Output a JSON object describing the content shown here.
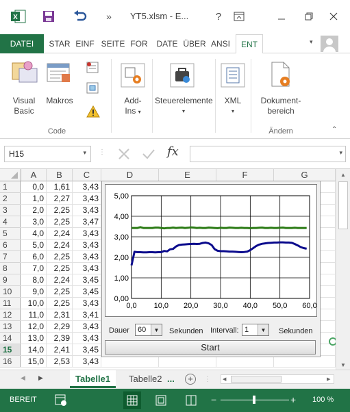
{
  "titlebar": {
    "app_icon": "excel-icon",
    "doc_title": "YT5.xlsm - E...",
    "help": "?",
    "colors": {
      "accent": "#217346"
    }
  },
  "ribbon_tabs": [
    "DATEI",
    "STAR",
    "EINF",
    "SEITE",
    "FOR",
    "DATE",
    "ÜBER",
    "ANSI",
    "ENT"
  ],
  "ribbon": {
    "code_group": {
      "visual_basic": [
        "Visual",
        "Basic"
      ],
      "makros": "Makros",
      "label": "Code"
    },
    "addins": [
      "Add-",
      "Ins"
    ],
    "controls": "Steuerelemente",
    "xml": "XML",
    "dokument": [
      "Dokument-",
      "bereich"
    ],
    "aendern_label": "Ändern"
  },
  "formula_bar": {
    "namebox": "H15",
    "fx": "fx",
    "value": ""
  },
  "grid": {
    "columns": [
      "A",
      "B",
      "C",
      "D",
      "E",
      "F",
      "G"
    ],
    "rows": [
      {
        "n": "1",
        "a": "0,0",
        "b": "1,61",
        "c": "3,43"
      },
      {
        "n": "2",
        "a": "1,0",
        "b": "2,27",
        "c": "3,43"
      },
      {
        "n": "3",
        "a": "2,0",
        "b": "2,25",
        "c": "3,43"
      },
      {
        "n": "4",
        "a": "3,0",
        "b": "2,25",
        "c": "3,47"
      },
      {
        "n": "5",
        "a": "4,0",
        "b": "2,24",
        "c": "3,43"
      },
      {
        "n": "6",
        "a": "5,0",
        "b": "2,24",
        "c": "3,43"
      },
      {
        "n": "7",
        "a": "6,0",
        "b": "2,25",
        "c": "3,43"
      },
      {
        "n": "8",
        "a": "7,0",
        "b": "2,25",
        "c": "3,43"
      },
      {
        "n": "9",
        "a": "8,0",
        "b": "2,24",
        "c": "3,45"
      },
      {
        "n": "10",
        "a": "9,0",
        "b": "2,25",
        "c": "3,45"
      },
      {
        "n": "11",
        "a": "10,0",
        "b": "2,25",
        "c": "3,43"
      },
      {
        "n": "12",
        "a": "11,0",
        "b": "2,31",
        "c": "3,41"
      },
      {
        "n": "13",
        "a": "12,0",
        "b": "2,29",
        "c": "3,43"
      },
      {
        "n": "14",
        "a": "13,0",
        "b": "2,39",
        "c": "3,43"
      },
      {
        "n": "15",
        "a": "14,0",
        "b": "2,41",
        "c": "3,45"
      },
      {
        "n": "16",
        "a": "15,0",
        "b": "2,53",
        "c": "3,43"
      }
    ],
    "selected_row": "15"
  },
  "form": {
    "dauer_label": "Dauer",
    "dauer_value": "60",
    "sekunden1": "Sekunden",
    "intervall_label": "Intervall:",
    "intervall_value": "1",
    "sekunden2": "Sekunden",
    "start": "Start"
  },
  "chart_data": {
    "type": "line",
    "title": "",
    "xlabel": "",
    "ylabel": "",
    "xlim": [
      0,
      60
    ],
    "ylim": [
      0,
      5
    ],
    "xticks": [
      "0,0",
      "10,0",
      "20,0",
      "30,0",
      "40,0",
      "50,0",
      "60,0"
    ],
    "yticks": [
      "0,00",
      "1,00",
      "2,00",
      "3,00",
      "4,00",
      "5,00"
    ],
    "grid": true,
    "x": [
      0,
      1,
      2,
      3,
      4,
      5,
      6,
      7,
      8,
      9,
      10,
      11,
      12,
      13,
      14,
      15,
      16,
      17,
      18,
      19,
      20,
      21,
      22,
      23,
      24,
      25,
      26,
      27,
      28,
      29,
      30,
      31,
      32,
      33,
      34,
      35,
      36,
      37,
      38,
      39,
      40,
      41,
      42,
      43,
      44,
      45,
      46,
      47,
      48,
      49,
      50,
      51,
      52,
      53,
      54,
      55,
      56,
      57,
      58,
      59
    ],
    "series": [
      {
        "color": "#0a0a8c",
        "values": [
          1.61,
          2.27,
          2.25,
          2.25,
          2.24,
          2.24,
          2.25,
          2.25,
          2.24,
          2.25,
          2.25,
          2.31,
          2.29,
          2.39,
          2.41,
          2.53,
          2.6,
          2.62,
          2.63,
          2.64,
          2.65,
          2.66,
          2.65,
          2.66,
          2.7,
          2.72,
          2.68,
          2.6,
          2.4,
          2.32,
          2.3,
          2.3,
          2.29,
          2.28,
          2.28,
          2.27,
          2.26,
          2.25,
          2.26,
          2.28,
          2.35,
          2.45,
          2.55,
          2.62,
          2.66,
          2.68,
          2.7,
          2.71,
          2.72,
          2.72,
          2.73,
          2.73,
          2.72,
          2.72,
          2.71,
          2.65,
          2.58,
          2.5,
          2.45,
          2.42
        ]
      },
      {
        "color": "#2a7a14",
        "values": [
          3.43,
          3.43,
          3.43,
          3.47,
          3.43,
          3.43,
          3.43,
          3.43,
          3.45,
          3.45,
          3.43,
          3.41,
          3.43,
          3.43,
          3.45,
          3.43,
          3.44,
          3.45,
          3.43,
          3.44,
          3.46,
          3.45,
          3.43,
          3.44,
          3.43,
          3.43,
          3.45,
          3.44,
          3.43,
          3.42,
          3.44,
          3.43,
          3.43,
          3.45,
          3.44,
          3.43,
          3.43,
          3.44,
          3.43,
          3.43,
          3.42,
          3.43,
          3.43,
          3.44,
          3.45,
          3.43,
          3.43,
          3.44,
          3.43,
          3.43,
          3.44,
          3.45,
          3.43,
          3.43,
          3.43,
          3.44,
          3.43,
          3.43,
          3.43,
          3.43
        ]
      }
    ]
  },
  "sheet_tabs": [
    "Tabelle1",
    "Tabelle2",
    "..."
  ],
  "statusbar": {
    "status": "BEREIT",
    "zoom": "100 %"
  }
}
